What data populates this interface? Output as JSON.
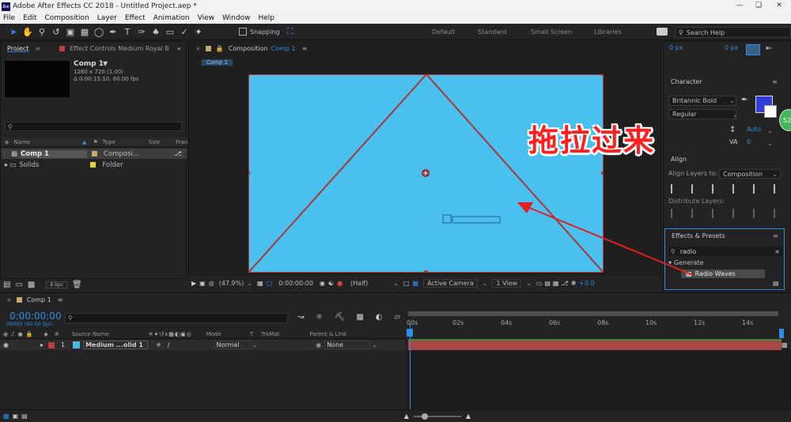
{
  "window": {
    "title": "Adobe After Effects CC 2018 - Untitled Project.aep *",
    "app_badge": "Ae"
  },
  "menu": [
    "File",
    "Edit",
    "Composition",
    "Layer",
    "Effect",
    "Animation",
    "View",
    "Window",
    "Help"
  ],
  "toolbar": {
    "snapping_label": "Snapping",
    "workspaces": [
      "Default",
      "Standard",
      "Small Screen",
      "Libraries"
    ],
    "search_help_placeholder": "Search Help"
  },
  "project_panel": {
    "tab_project": "Project",
    "tab_effect_controls": "Effect Controls Medium Royal B",
    "comp_name": "Comp 1",
    "comp_details": [
      "1280 x 720 (1.00)",
      "Δ 0:00:15:10, 60.00 fps"
    ],
    "columns": [
      "Name",
      "Type",
      "Size",
      "Fran"
    ],
    "items": [
      {
        "name": "Comp 1",
        "type": "Composi...",
        "color": "#c8a96a"
      },
      {
        "name": "Solids",
        "type": "Folder",
        "color": "#e6d23c"
      }
    ],
    "bpc": "8 bpc"
  },
  "comp_panel": {
    "tab_label": "Composition",
    "tab_comp": "Comp 1",
    "breadcrumb": "Comp 1",
    "zoom": "(47.9%)",
    "timecode": "0:00:00:00",
    "resolution": "(Half)",
    "camera": "Active Camera",
    "views": "1 View",
    "exposure": "+0.0",
    "canvas_color": "#4ac0ee"
  },
  "character": {
    "title": "Character",
    "top_values": [
      "0 px",
      "0 px"
    ],
    "font": "Britannic Bold",
    "style": "Regular",
    "leading": "Auto",
    "tracking": "0",
    "fill_color": "#2f3ed6"
  },
  "align": {
    "title": "Align",
    "align_to_label": "Align Layers to:",
    "align_to_value": "Composition",
    "distribute_label": "Distribute Layers:"
  },
  "effects_presets": {
    "title": "Effects & Presets",
    "search_value": "radio",
    "category": "Generate",
    "result": "Radio Waves"
  },
  "overlay": {
    "annotation": "拖拉过来",
    "badge": "52"
  },
  "timeline": {
    "tab": "Comp 1",
    "timecode": "0:00:00:00",
    "timecode_sub": "00000 (60.00 fps)",
    "columns": [
      "#",
      "Source Name",
      "Mode",
      "T",
      "TrkMat",
      "Parent & Link"
    ],
    "ruler_ticks": [
      "00s",
      "02s",
      "04s",
      "06s",
      "08s",
      "10s",
      "12s",
      "14s"
    ],
    "layer": {
      "index": "1",
      "name": "Medium ...olid 1",
      "mode": "Normal",
      "parent": "None",
      "color": "#4ab8e8",
      "label_color": "#c03c3c"
    }
  }
}
